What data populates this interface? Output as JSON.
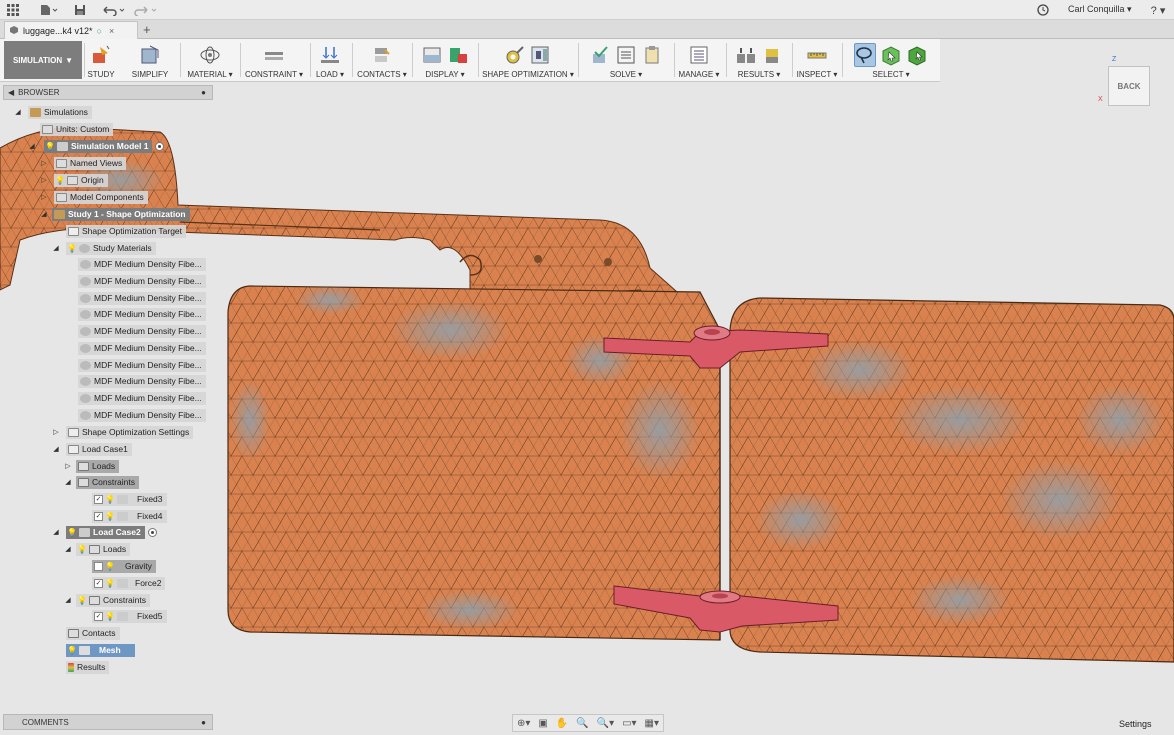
{
  "titlebar": {
    "user_name": "Carl Conquilla ▾",
    "help_label": "? ▾"
  },
  "tab": {
    "title": "luggage...k4 v12*",
    "close": "×",
    "add": "+"
  },
  "toolbar": {
    "workspace": "SIMULATION",
    "groups": {
      "study": "STUDY",
      "simplify": "SIMPLIFY",
      "material": "MATERIAL ▾",
      "constraint": "CONSTRAINT ▾",
      "load": "LOAD ▾",
      "contacts": "CONTACTS ▾",
      "display": "DISPLAY ▾",
      "shape_optimization": "SHAPE OPTIMIZATION ▾",
      "solve": "SOLVE ▾",
      "manage": "MANAGE ▾",
      "results": "RESULTS ▾",
      "inspect": "INSPECT ▾",
      "select": "SELECT ▾"
    }
  },
  "browser": {
    "header": "BROWSER",
    "items": {
      "simulations": "Simulations",
      "units": "Units: Custom",
      "sim_model": "Simulation Model 1",
      "named_views": "Named Views",
      "origin": "Origin",
      "model_components": "Model Components",
      "study": "Study 1 - Shape Optimization",
      "shape_target": "Shape Optimization Target",
      "study_materials": "Study Materials",
      "material": "MDF Medium Density Fibe...",
      "shape_settings": "Shape Optimization Settings",
      "load_case1": "Load Case1",
      "loads": "Loads",
      "constraints": "Constraints",
      "fixed3": "Fixed3",
      "fixed4": "Fixed4",
      "load_case2": "Load Case2",
      "gravity": "Gravity",
      "force2": "Force2",
      "fixed5": "Fixed5",
      "contacts": "Contacts",
      "mesh": "Mesh",
      "results": "Results"
    }
  },
  "footer": {
    "comments": "COMMENTS",
    "settings": "Settings"
  },
  "viewcube": {
    "face": "BACK",
    "x": "X",
    "z": "Z"
  },
  "colors": {
    "part": "#d9824f",
    "stress": "#8fa1ad",
    "hinge": "#d95a66",
    "mesh_line": "#4a2a14"
  }
}
